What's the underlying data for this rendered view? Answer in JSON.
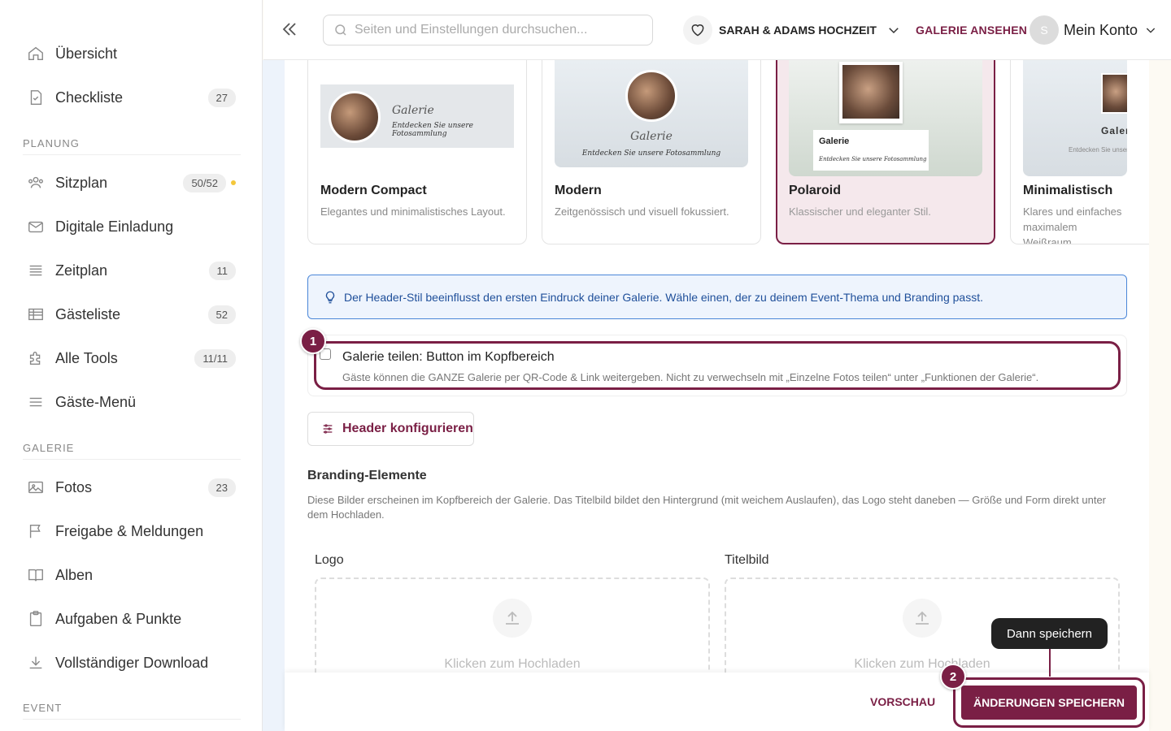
{
  "sidebar": {
    "items": [
      {
        "label": "Übersicht",
        "badge": ""
      },
      {
        "label": "Checkliste",
        "badge": "27"
      },
      {
        "label": "Sitzplan",
        "badge": "50/52"
      },
      {
        "label": "Digitale Einladung",
        "badge": ""
      },
      {
        "label": "Zeitplan",
        "badge": "11"
      },
      {
        "label": "Gästeliste",
        "badge": "52"
      },
      {
        "label": "Alle Tools",
        "badge": "11/11"
      },
      {
        "label": "Gäste-Menü",
        "badge": ""
      },
      {
        "label": "Fotos",
        "badge": "23"
      },
      {
        "label": "Freigabe & Meldungen",
        "badge": ""
      },
      {
        "label": "Alben",
        "badge": ""
      },
      {
        "label": "Aufgaben & Punkte",
        "badge": ""
      },
      {
        "label": "Vollständiger Download",
        "badge": ""
      }
    ],
    "sections": {
      "planning": "PLANUNG",
      "gallery": "GALERIE",
      "event": "EVENT"
    }
  },
  "topbar": {
    "search_placeholder": "Seiten und Einstellungen durchsuchen...",
    "event_name": "SARAH & ADAMS HOCHZEIT",
    "gallery_link": "GALERIE ANSEHEN",
    "avatar_initial": "S",
    "account_label": "Mein Konto"
  },
  "header_styles": [
    {
      "title": "Modern Compact",
      "desc": "Elegantes und minimalistisches Layout.",
      "thumb_title": "Galerie",
      "thumb_sub": "Entdecken Sie unsere Fotosammlung"
    },
    {
      "title": "Modern",
      "desc": "Zeitgenössisch und visuell fokussiert.",
      "thumb_title": "Galerie",
      "thumb_sub": "Entdecken Sie unsere Fotosammlung"
    },
    {
      "title": "Polaroid",
      "desc": "Klassischer und eleganter Stil.",
      "thumb_title": "Galerie",
      "thumb_sub": "Entdecken Sie unsere Fotosammlung"
    },
    {
      "title": "Minimalistisch",
      "desc": "Klares und einfaches maximalem Weißraum",
      "thumb_title": "Galer",
      "thumb_sub": "Entdecken Sie unsere"
    }
  ],
  "selected_style": "Polaroid",
  "hint": "Der Header-Stil beeinflusst den ersten Eindruck deiner Galerie. Wähle einen, der zu deinem Event-Thema und Branding passt.",
  "share_toggle": {
    "title": "Galerie teilen: Button im Kopfbereich",
    "desc": "Gäste können die GANZE Galerie per QR-Code & Link weitergeben. Nicht zu verwechseln mit „Einzelne Fotos teilen“ unter „Funktionen der Galerie“.",
    "checked": false
  },
  "configure_button": "Header konfigurieren",
  "branding": {
    "title": "Branding-Elemente",
    "desc": "Diese Bilder erscheinen im Kopfbereich der Galerie. Das Titelbild bildet den Hintergrund (mit weichem Auslaufen), das Logo steht daneben — Größe und Form direkt unter dem Hochladen.",
    "logo_label": "Logo",
    "cover_label": "Titelbild",
    "upload_text": "Klicken zum Hochladen"
  },
  "footer": {
    "preview": "VORSCHAU",
    "save": "ÄNDERUNGEN SPEICHERN"
  },
  "tutorial": {
    "step1": "1",
    "step2": "2",
    "tooltip": "Dann speichern"
  },
  "colors": {
    "accent": "#7a1f45",
    "info_border": "#4a86d8",
    "info_bg": "#eef4fd"
  }
}
